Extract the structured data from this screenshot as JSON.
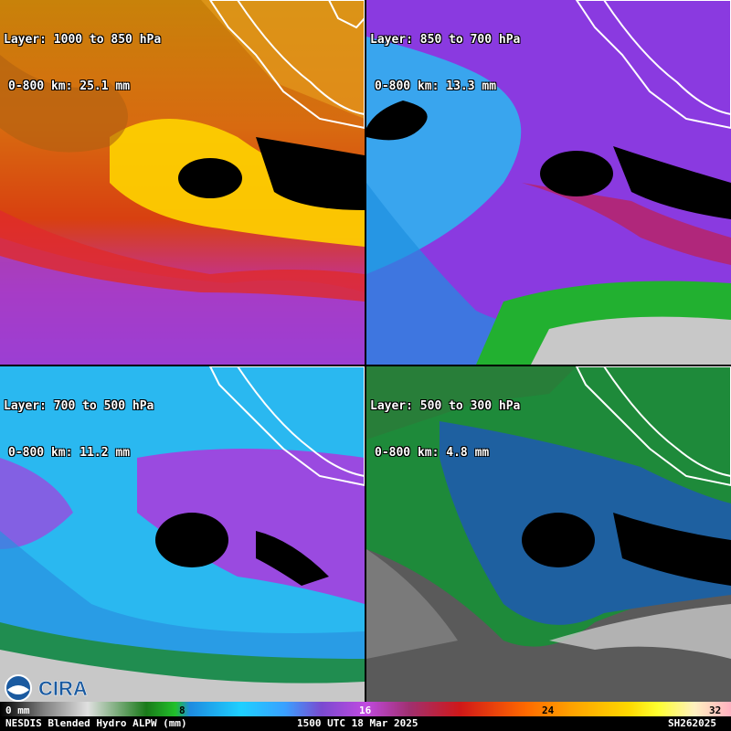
{
  "panels": [
    {
      "layer": "Layer: 1000 to 850 hPa",
      "stat": "0-800 km: 25.1 mm",
      "palette": "orange-yellow"
    },
    {
      "layer": "Layer: 850 to 700 hPa",
      "stat": "0-800 km: 13.3 mm",
      "palette": "cyan-purple"
    },
    {
      "layer": "Layer: 700 to 500 hPa",
      "stat": "0-800 km: 11.2 mm",
      "palette": "cyan-purple"
    },
    {
      "layer": "Layer: 500 to 300 hPa",
      "stat": "0-800 km: 4.8 mm",
      "palette": "green-gray"
    }
  ],
  "colorbar": {
    "ticks": [
      "0 mm",
      "8",
      "16",
      "24",
      "32"
    ],
    "units": "mm"
  },
  "footer": {
    "product": "NESDIS Blended Hydro ALPW (mm)",
    "time": "1500 UTC 18 Mar 2025",
    "id": "SH262025"
  },
  "logos": [
    "noaa-logo",
    "cira-logo"
  ],
  "colors": {
    "coast": "#ffffff",
    "missing": "#000000"
  }
}
